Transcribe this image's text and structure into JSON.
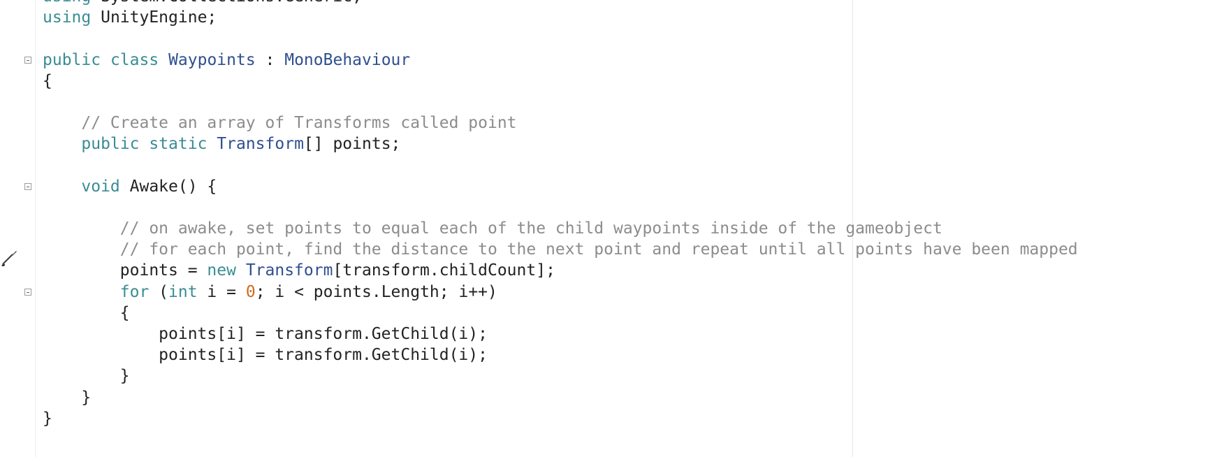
{
  "editor": {
    "language": "csharp",
    "lines": [
      {
        "tokens": [
          {
            "c": "kw",
            "t": "using"
          },
          {
            "c": "",
            "t": " System.Collections.Generic;"
          }
        ]
      },
      {
        "tokens": [
          {
            "c": "kw",
            "t": "using"
          },
          {
            "c": "",
            "t": " UnityEngine;"
          }
        ]
      },
      {
        "tokens": []
      },
      {
        "tokens": [
          {
            "c": "kw",
            "t": "public"
          },
          {
            "c": "",
            "t": " "
          },
          {
            "c": "kw",
            "t": "class"
          },
          {
            "c": "",
            "t": " "
          },
          {
            "c": "type",
            "t": "Waypoints"
          },
          {
            "c": "",
            "t": " : "
          },
          {
            "c": "type",
            "t": "MonoBehaviour"
          }
        ]
      },
      {
        "tokens": [
          {
            "c": "",
            "t": "{"
          }
        ]
      },
      {
        "tokens": []
      },
      {
        "tokens": [
          {
            "c": "",
            "t": "    "
          },
          {
            "c": "cm",
            "t": "// Create an array of Transforms called point"
          }
        ]
      },
      {
        "tokens": [
          {
            "c": "",
            "t": "    "
          },
          {
            "c": "kw",
            "t": "public"
          },
          {
            "c": "",
            "t": " "
          },
          {
            "c": "kw",
            "t": "static"
          },
          {
            "c": "",
            "t": " "
          },
          {
            "c": "type",
            "t": "Transform"
          },
          {
            "c": "",
            "t": "[] points;"
          }
        ]
      },
      {
        "tokens": []
      },
      {
        "tokens": [
          {
            "c": "",
            "t": "    "
          },
          {
            "c": "kw",
            "t": "void"
          },
          {
            "c": "",
            "t": " Awake() {"
          }
        ]
      },
      {
        "tokens": []
      },
      {
        "tokens": [
          {
            "c": "",
            "t": "        "
          },
          {
            "c": "cm",
            "t": "// on awake, set points to equal each of the child waypoints inside of the gameobject"
          }
        ]
      },
      {
        "tokens": [
          {
            "c": "",
            "t": "        "
          },
          {
            "c": "cm",
            "t": "// for each point, find the distance to the next point and repeat until all points have been mapped"
          }
        ]
      },
      {
        "tokens": [
          {
            "c": "",
            "t": "        points = "
          },
          {
            "c": "kw",
            "t": "new"
          },
          {
            "c": "",
            "t": " "
          },
          {
            "c": "type",
            "t": "Transform"
          },
          {
            "c": "",
            "t": "[transform.childCount];"
          }
        ]
      },
      {
        "tokens": [
          {
            "c": "",
            "t": "        "
          },
          {
            "c": "kw",
            "t": "for"
          },
          {
            "c": "",
            "t": " ("
          },
          {
            "c": "kw",
            "t": "int"
          },
          {
            "c": "",
            "t": " i = "
          },
          {
            "c": "num",
            "t": "0"
          },
          {
            "c": "",
            "t": "; i < points.Length; i++)"
          }
        ]
      },
      {
        "tokens": [
          {
            "c": "",
            "t": "        {"
          }
        ]
      },
      {
        "tokens": [
          {
            "c": "",
            "t": "            points[i] = transform.GetChild(i);"
          }
        ]
      },
      {
        "tokens": [
          {
            "c": "",
            "t": "            points[i] = transform.GetChild(i);"
          }
        ]
      },
      {
        "tokens": [
          {
            "c": "",
            "t": "        }"
          }
        ]
      },
      {
        "tokens": [
          {
            "c": "",
            "t": "    }"
          }
        ]
      },
      {
        "tokens": [
          {
            "c": "",
            "t": "}"
          }
        ]
      }
    ],
    "fold_markers": [
      3,
      9,
      14
    ],
    "cursor_marker_line": 12
  },
  "colors": {
    "keyword": "#3a8c95",
    "type": "#2f4f8f",
    "comment": "#8c8c8c",
    "number": "#d06a20",
    "text": "#222222"
  },
  "icons": {
    "fold": "collapse-box-icon",
    "marker": "paintbrush-icon"
  }
}
